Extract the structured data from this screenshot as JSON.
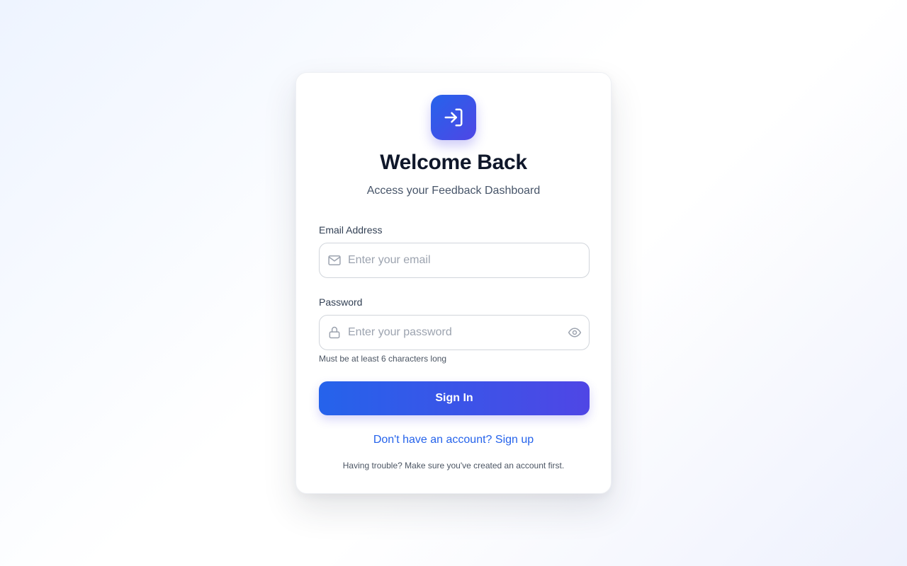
{
  "header": {
    "title": "Welcome Back",
    "subtitle": "Access your Feedback Dashboard",
    "logo_icon": "login-arrow-icon"
  },
  "form": {
    "email": {
      "label": "Email Address",
      "placeholder": "Enter your email",
      "value": "",
      "icon": "mail-icon"
    },
    "password": {
      "label": "Password",
      "placeholder": "Enter your password",
      "value": "",
      "icon": "lock-icon",
      "toggle_icon": "eye-icon",
      "hint": "Must be at least 6 characters long"
    },
    "submit_label": "Sign In"
  },
  "footer": {
    "signup_link": "Don't have an account? Sign up",
    "trouble_text": "Having trouble? Make sure you've created an account first."
  },
  "colors": {
    "accent_start": "#2563eb",
    "accent_end": "#4f46e5",
    "title": "#0f172a",
    "link": "#2563eb"
  }
}
